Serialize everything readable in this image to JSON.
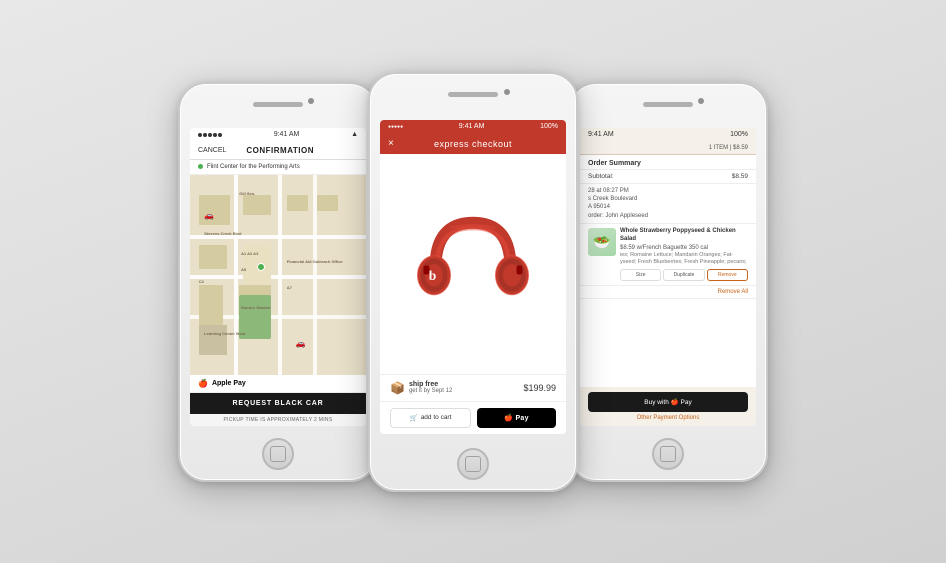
{
  "phones": [
    {
      "id": "uber",
      "type": "uber",
      "status_bar": {
        "dots": 5,
        "time": "9:41 AM",
        "wifi": "wifi"
      },
      "header": {
        "cancel": "CANCEL",
        "title": "CONFIRMATION"
      },
      "destination": "Flint Center for the Performing Arts",
      "apple_pay_label": "Apple Pay",
      "button_label": "REQUEST BLACK CAR",
      "pickup_label": "PICKUP TIME IS APPROXIMATELY 2 MINS"
    },
    {
      "id": "checkout",
      "type": "checkout",
      "status_bar": {
        "dots": 5,
        "time": "9:41 AM",
        "battery": "100%"
      },
      "header": {
        "close": "×",
        "title": "express checkout"
      },
      "product": {
        "name": "Beats Solo2 Wireless",
        "color": "red"
      },
      "shipping": {
        "label": "ship free",
        "sublabel": "get it by Sept 12",
        "price": "$199.99"
      },
      "actions": {
        "add_to_cart": "add to cart",
        "apple_pay": "Apple Pay"
      }
    },
    {
      "id": "order",
      "type": "order",
      "status_bar": {
        "time": "9:41 AM",
        "battery": "100%"
      },
      "header": {
        "item_count": "1 ITEM | $8.59"
      },
      "summary": {
        "title": "Order Summary",
        "subtotal_label": "Subtotal:",
        "subtotal_value": "$8.59",
        "meta_line1": "28 at 08:27 PM",
        "meta_line2": "s Creek Boulevard",
        "meta_line3": "A 95014",
        "order_name_label": "order:",
        "order_name": "John Appleseed"
      },
      "item": {
        "name": "Whole Strawberry Poppyseed & Chicken Salad",
        "price": "$8.59 w/French Baguette  350 cal",
        "description": "ies; Romaine Lettuce; Mandarin Oranges; Fat- yseed; Fresh Blueberries; Fresh Pineapple; pecans;",
        "actions": [
          "Size",
          "Duplicate",
          "Remove"
        ]
      },
      "remove_all": "Remove All",
      "footer": {
        "buy_label": "Buy with  Pay",
        "other_payment": "Other Payment Options"
      }
    }
  ]
}
